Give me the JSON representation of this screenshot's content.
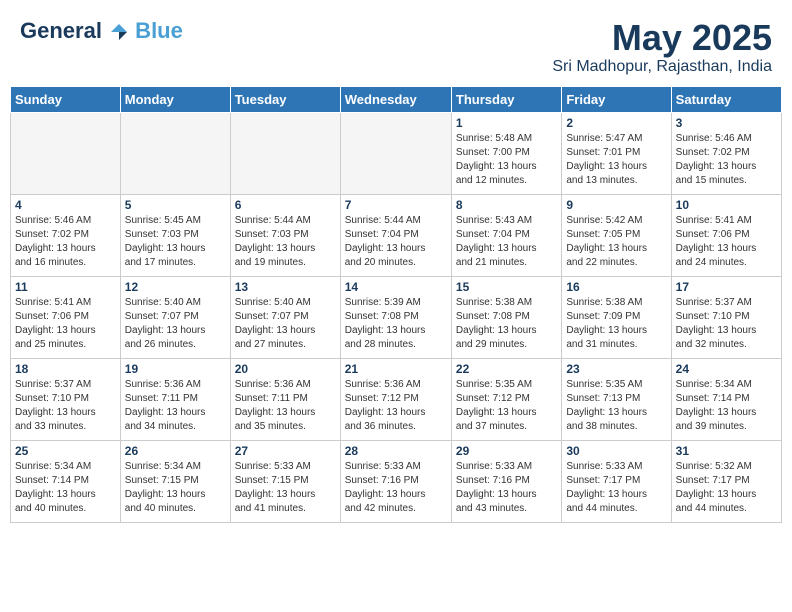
{
  "header": {
    "logo_general": "General",
    "logo_blue": "Blue",
    "month_title": "May 2025",
    "subtitle": "Sri Madhopur, Rajasthan, India"
  },
  "weekdays": [
    "Sunday",
    "Monday",
    "Tuesday",
    "Wednesday",
    "Thursday",
    "Friday",
    "Saturday"
  ],
  "weeks": [
    [
      {
        "day": "",
        "info": ""
      },
      {
        "day": "",
        "info": ""
      },
      {
        "day": "",
        "info": ""
      },
      {
        "day": "",
        "info": ""
      },
      {
        "day": "1",
        "info": "Sunrise: 5:48 AM\nSunset: 7:00 PM\nDaylight: 13 hours\nand 12 minutes."
      },
      {
        "day": "2",
        "info": "Sunrise: 5:47 AM\nSunset: 7:01 PM\nDaylight: 13 hours\nand 13 minutes."
      },
      {
        "day": "3",
        "info": "Sunrise: 5:46 AM\nSunset: 7:02 PM\nDaylight: 13 hours\nand 15 minutes."
      }
    ],
    [
      {
        "day": "4",
        "info": "Sunrise: 5:46 AM\nSunset: 7:02 PM\nDaylight: 13 hours\nand 16 minutes."
      },
      {
        "day": "5",
        "info": "Sunrise: 5:45 AM\nSunset: 7:03 PM\nDaylight: 13 hours\nand 17 minutes."
      },
      {
        "day": "6",
        "info": "Sunrise: 5:44 AM\nSunset: 7:03 PM\nDaylight: 13 hours\nand 19 minutes."
      },
      {
        "day": "7",
        "info": "Sunrise: 5:44 AM\nSunset: 7:04 PM\nDaylight: 13 hours\nand 20 minutes."
      },
      {
        "day": "8",
        "info": "Sunrise: 5:43 AM\nSunset: 7:04 PM\nDaylight: 13 hours\nand 21 minutes."
      },
      {
        "day": "9",
        "info": "Sunrise: 5:42 AM\nSunset: 7:05 PM\nDaylight: 13 hours\nand 22 minutes."
      },
      {
        "day": "10",
        "info": "Sunrise: 5:41 AM\nSunset: 7:06 PM\nDaylight: 13 hours\nand 24 minutes."
      }
    ],
    [
      {
        "day": "11",
        "info": "Sunrise: 5:41 AM\nSunset: 7:06 PM\nDaylight: 13 hours\nand 25 minutes."
      },
      {
        "day": "12",
        "info": "Sunrise: 5:40 AM\nSunset: 7:07 PM\nDaylight: 13 hours\nand 26 minutes."
      },
      {
        "day": "13",
        "info": "Sunrise: 5:40 AM\nSunset: 7:07 PM\nDaylight: 13 hours\nand 27 minutes."
      },
      {
        "day": "14",
        "info": "Sunrise: 5:39 AM\nSunset: 7:08 PM\nDaylight: 13 hours\nand 28 minutes."
      },
      {
        "day": "15",
        "info": "Sunrise: 5:38 AM\nSunset: 7:08 PM\nDaylight: 13 hours\nand 29 minutes."
      },
      {
        "day": "16",
        "info": "Sunrise: 5:38 AM\nSunset: 7:09 PM\nDaylight: 13 hours\nand 31 minutes."
      },
      {
        "day": "17",
        "info": "Sunrise: 5:37 AM\nSunset: 7:10 PM\nDaylight: 13 hours\nand 32 minutes."
      }
    ],
    [
      {
        "day": "18",
        "info": "Sunrise: 5:37 AM\nSunset: 7:10 PM\nDaylight: 13 hours\nand 33 minutes."
      },
      {
        "day": "19",
        "info": "Sunrise: 5:36 AM\nSunset: 7:11 PM\nDaylight: 13 hours\nand 34 minutes."
      },
      {
        "day": "20",
        "info": "Sunrise: 5:36 AM\nSunset: 7:11 PM\nDaylight: 13 hours\nand 35 minutes."
      },
      {
        "day": "21",
        "info": "Sunrise: 5:36 AM\nSunset: 7:12 PM\nDaylight: 13 hours\nand 36 minutes."
      },
      {
        "day": "22",
        "info": "Sunrise: 5:35 AM\nSunset: 7:12 PM\nDaylight: 13 hours\nand 37 minutes."
      },
      {
        "day": "23",
        "info": "Sunrise: 5:35 AM\nSunset: 7:13 PM\nDaylight: 13 hours\nand 38 minutes."
      },
      {
        "day": "24",
        "info": "Sunrise: 5:34 AM\nSunset: 7:14 PM\nDaylight: 13 hours\nand 39 minutes."
      }
    ],
    [
      {
        "day": "25",
        "info": "Sunrise: 5:34 AM\nSunset: 7:14 PM\nDaylight: 13 hours\nand 40 minutes."
      },
      {
        "day": "26",
        "info": "Sunrise: 5:34 AM\nSunset: 7:15 PM\nDaylight: 13 hours\nand 40 minutes."
      },
      {
        "day": "27",
        "info": "Sunrise: 5:33 AM\nSunset: 7:15 PM\nDaylight: 13 hours\nand 41 minutes."
      },
      {
        "day": "28",
        "info": "Sunrise: 5:33 AM\nSunset: 7:16 PM\nDaylight: 13 hours\nand 42 minutes."
      },
      {
        "day": "29",
        "info": "Sunrise: 5:33 AM\nSunset: 7:16 PM\nDaylight: 13 hours\nand 43 minutes."
      },
      {
        "day": "30",
        "info": "Sunrise: 5:33 AM\nSunset: 7:17 PM\nDaylight: 13 hours\nand 44 minutes."
      },
      {
        "day": "31",
        "info": "Sunrise: 5:32 AM\nSunset: 7:17 PM\nDaylight: 13 hours\nand 44 minutes."
      }
    ]
  ]
}
